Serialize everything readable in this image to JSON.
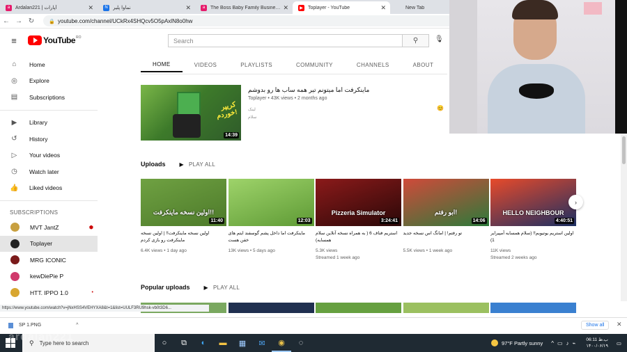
{
  "browser": {
    "tabs": [
      {
        "label": "Ardalan221 | آپارات",
        "fav_color": "#e61a6b",
        "fav_glyph": "a"
      },
      {
        "label": "نماوا پلیر",
        "fav_color": "#1a73e8",
        "fav_glyph": "N"
      },
      {
        "label": "The Boss Baby Family Business ...",
        "fav_color": "#e61a6b",
        "fav_glyph": "a"
      },
      {
        "label": "Toplayer - YouTube",
        "fav_color": "#ff0000",
        "fav_glyph": "▶"
      },
      {
        "label": "New Tab",
        "fav_color": "#dee1e6",
        "fav_glyph": ""
      }
    ],
    "url": "youtube.com/channel/UCkRx4SHQcv5O5pAxlN8o0hw"
  },
  "youtube": {
    "logo_text": "YouTube",
    "logo_region": "RO",
    "search_placeholder": "Search"
  },
  "sidebar": {
    "main": [
      {
        "label": "Home",
        "icon": "home-icon",
        "glyph": "⌂"
      },
      {
        "label": "Explore",
        "icon": "compass-icon",
        "glyph": "◎"
      },
      {
        "label": "Subscriptions",
        "icon": "subscriptions-icon",
        "glyph": "▤"
      }
    ],
    "library": [
      {
        "label": "Library",
        "icon": "library-icon",
        "glyph": "▶"
      },
      {
        "label": "History",
        "icon": "history-icon",
        "glyph": "↺"
      },
      {
        "label": "Your videos",
        "icon": "your-videos-icon",
        "glyph": "▷"
      },
      {
        "label": "Watch later",
        "icon": "clock-icon",
        "glyph": "◷"
      },
      {
        "label": "Liked videos",
        "icon": "thumbs-up-icon",
        "glyph": "👍"
      }
    ],
    "subs_heading": "SUBSCRIPTIONS",
    "subs": [
      {
        "label": "MVT JantZ",
        "color": "#c8a040",
        "badge": "⬢"
      },
      {
        "label": "Toplayer",
        "color": "#222222",
        "badge": ""
      },
      {
        "label": "MRG ICONIC",
        "color": "#7a1a1a",
        "badge": ""
      },
      {
        "label": "kewDiePie P",
        "color": "#d03a6c",
        "badge": ""
      },
      {
        "label": "HTT. IPPO 1.0",
        "color": "#d8a630",
        "badge": "•"
      }
    ]
  },
  "channel_tabs": [
    "HOME",
    "VIDEOS",
    "PLAYLISTS",
    "COMMUNITY",
    "CHANNELS",
    "ABOUT"
  ],
  "featured": {
    "title": "ماینکرفت اما میتونم تیر همه ساب ها رو بدوشم",
    "meta": "Toplayer • 43K views • 2 months ago",
    "desc1": "لینک",
    "desc2": "سلام",
    "thumb_text": "کریپر خوردم!",
    "duration": "14:39",
    "emoji": "😊"
  },
  "uploads": {
    "heading": "Uploads",
    "play_all": "PLAY ALL",
    "videos": [
      {
        "title": "اولین نسخه ماینکرفت!! | اولین نسخه ماینکرفت رو بازی کردم",
        "views": "6.4K views • 1 day ago",
        "duration": "11:40",
        "thumb_text": "اولین نسخه ماینکرفت!!",
        "c1": "#6fa142",
        "c2": "#4d7a2a"
      },
      {
        "title": "ماینکرفت اما داخل پشم گوسفند ایتم های خفن هست",
        "views": "13K views • 5 days ago",
        "duration": "12:03",
        "thumb_text": "",
        "c1": "#9ed36a",
        "c2": "#5e9a35"
      },
      {
        "title": "استریم فناف 6 ( به همراه نسخه آنلاین سلام همسایه)",
        "views": "5.3K views",
        "views2": "Streamed 1 week ago",
        "duration": "3:24:41",
        "thumb_text": "Pizzeria Simulator",
        "c1": "#8b1a1a",
        "c2": "#2a0808"
      },
      {
        "title": "تو رفتم! | امانگ اس نسخه جدید",
        "views": "5.5K views • 1 week ago",
        "duration": "14:06",
        "thumb_text": "ابو رفتم!",
        "c1": "#d04a3a",
        "c2": "#2c7a3a"
      },
      {
        "title": "اولین استریم یوتیوبم!! (سلام همسایه آمپیرایر 1)",
        "views": "11K views",
        "views2": "Streamed 2 weeks ago",
        "duration": "4:40:51",
        "thumb_text": "HELLO NEIGHBOUR",
        "c1": "#e84a2a",
        "c2": "#1b2f63"
      }
    ]
  },
  "popular": {
    "heading": "Popular uploads",
    "play_all": "PLAY ALL",
    "thumbs": [
      "#7aa860",
      "#203050",
      "#66a040",
      "#9bc060",
      "#3a80d0"
    ]
  },
  "status_url": "https://www.youtube.com/watch?v=jNxHSS4VEHYXA8&t=1&list=UULF3RU9hsk-vb0t3D6...",
  "downloads": {
    "file": "SP 1.PNG",
    "show_all": "Show all"
  },
  "taskbar": {
    "search_placeholder": "Type here to search",
    "weather": "97°F  Partly sunny",
    "time": "06:11 ب.ظ",
    "date": "۱۴۰۰/۰۶/۱۹",
    "watermark": "ardalan221"
  }
}
